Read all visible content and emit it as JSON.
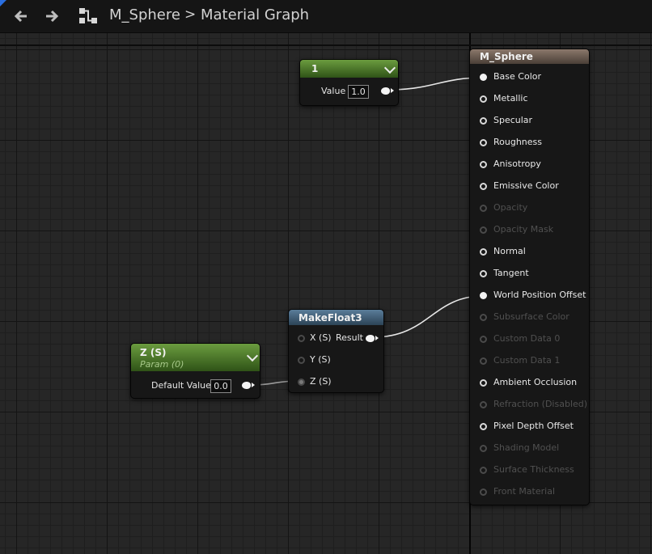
{
  "breadcrumb": {
    "asset": "M_Sphere",
    "separator": ">",
    "graph": "Material Graph"
  },
  "nodes": {
    "constant": {
      "title": "1",
      "value_label": "Value",
      "value": "1.0"
    },
    "param": {
      "title": "Z (S)",
      "subtitle": "Param (0)",
      "value_label": "Default Value",
      "value": "0.0"
    },
    "makefloat": {
      "title": "MakeFloat3",
      "inputs": [
        "X (S)",
        "Y (S)",
        "Z (S)"
      ],
      "output": "Result"
    },
    "material": {
      "title": "M_Sphere",
      "pins": [
        {
          "label": "Base Color",
          "enabled": true,
          "connected": true
        },
        {
          "label": "Metallic",
          "enabled": true,
          "connected": false
        },
        {
          "label": "Specular",
          "enabled": true,
          "connected": false
        },
        {
          "label": "Roughness",
          "enabled": true,
          "connected": false
        },
        {
          "label": "Anisotropy",
          "enabled": true,
          "connected": false
        },
        {
          "label": "Emissive Color",
          "enabled": true,
          "connected": false
        },
        {
          "label": "Opacity",
          "enabled": false,
          "connected": false
        },
        {
          "label": "Opacity Mask",
          "enabled": false,
          "connected": false
        },
        {
          "label": "Normal",
          "enabled": true,
          "connected": false
        },
        {
          "label": "Tangent",
          "enabled": true,
          "connected": false
        },
        {
          "label": "World Position Offset",
          "enabled": true,
          "connected": true
        },
        {
          "label": "Subsurface Color",
          "enabled": false,
          "connected": false
        },
        {
          "label": "Custom Data 0",
          "enabled": false,
          "connected": false
        },
        {
          "label": "Custom Data 1",
          "enabled": false,
          "connected": false
        },
        {
          "label": "Ambient Occlusion",
          "enabled": true,
          "connected": false
        },
        {
          "label": "Refraction (Disabled)",
          "enabled": false,
          "connected": false
        },
        {
          "label": "Pixel Depth Offset",
          "enabled": true,
          "connected": false
        },
        {
          "label": "Shading Model",
          "enabled": false,
          "connected": false
        },
        {
          "label": "Surface Thickness",
          "enabled": false,
          "connected": false
        },
        {
          "label": "Front Material",
          "enabled": false,
          "connected": false
        }
      ]
    }
  },
  "colors": {
    "param_header": "#4f7d2b",
    "makefloat_header": "#3f5e78",
    "material_header": "#6b5c51"
  }
}
